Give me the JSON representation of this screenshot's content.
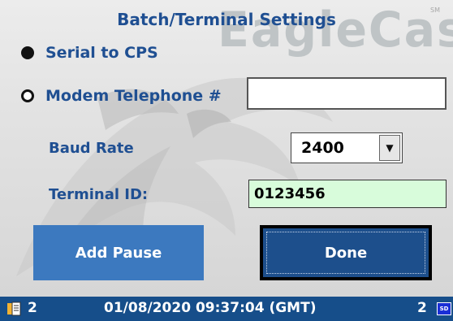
{
  "title": "Batch/Terminal Settings",
  "watermark": {
    "brand": "EagleCash",
    "trademark": "SM"
  },
  "radios": [
    {
      "label": "Serial to CPS",
      "selected": true
    },
    {
      "label": "Modem Telephone #",
      "selected": false
    }
  ],
  "telephone": {
    "value": ""
  },
  "baud": {
    "label": "Baud Rate",
    "value": "2400"
  },
  "terminal": {
    "label": "Terminal ID:",
    "value": "0123456"
  },
  "buttons": {
    "add_pause": "Add Pause",
    "done": "Done"
  },
  "statusbar": {
    "left_count": "2",
    "datetime": "01/08/2020 09:37:04 (GMT)",
    "right_count": "2",
    "sd_icon_text": "SD"
  },
  "colors": {
    "title": "#1f4f92",
    "add_pause": "#3c79bf",
    "done": "#1d4f8c",
    "terminal_bg": "#d8fcdb",
    "statusbar": "#164e8a"
  }
}
